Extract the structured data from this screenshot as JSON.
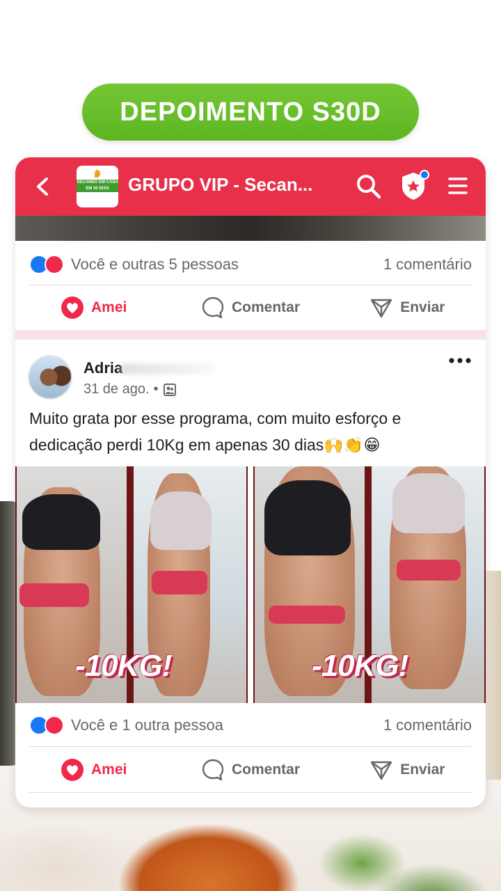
{
  "badge": {
    "label": "DEPOIMENTO S30D"
  },
  "topbar": {
    "title": "GRUPO VIP - Secan...",
    "logo_text": "SECANDO EM CASA EM 30 DIAS",
    "accent_color": "#e8304a"
  },
  "prev_post": {
    "reactions_text": "Você e outras 5 pessoas",
    "comments_text": "1 comentário"
  },
  "actions": {
    "love": "Amei",
    "comment": "Comentar",
    "send": "Enviar"
  },
  "post": {
    "author": "Adria",
    "date": "31 de ago.",
    "meta_dot": "•",
    "text": "Muito grata por esse programa, com muito esforço e dedicação perdi 10Kg em apenas 30 dias🙌👏😁",
    "photo_labels": [
      "-10KG!",
      "-10KG!"
    ],
    "reactions_text": "Você e 1 outra pessoa",
    "comments_text": "1 comentário"
  },
  "icons": {
    "back": "back-arrow-icon",
    "search": "search-icon",
    "admin": "shield-star-icon",
    "menu": "menu-icon",
    "more": "more-icon",
    "audience": "audience-icon",
    "like": "like-icon",
    "love": "love-icon",
    "comment": "comment-icon",
    "send": "send-icon"
  },
  "colors": {
    "badge_green": "#5db522",
    "love_red": "#f0284a",
    "like_blue": "#1877f2"
  }
}
